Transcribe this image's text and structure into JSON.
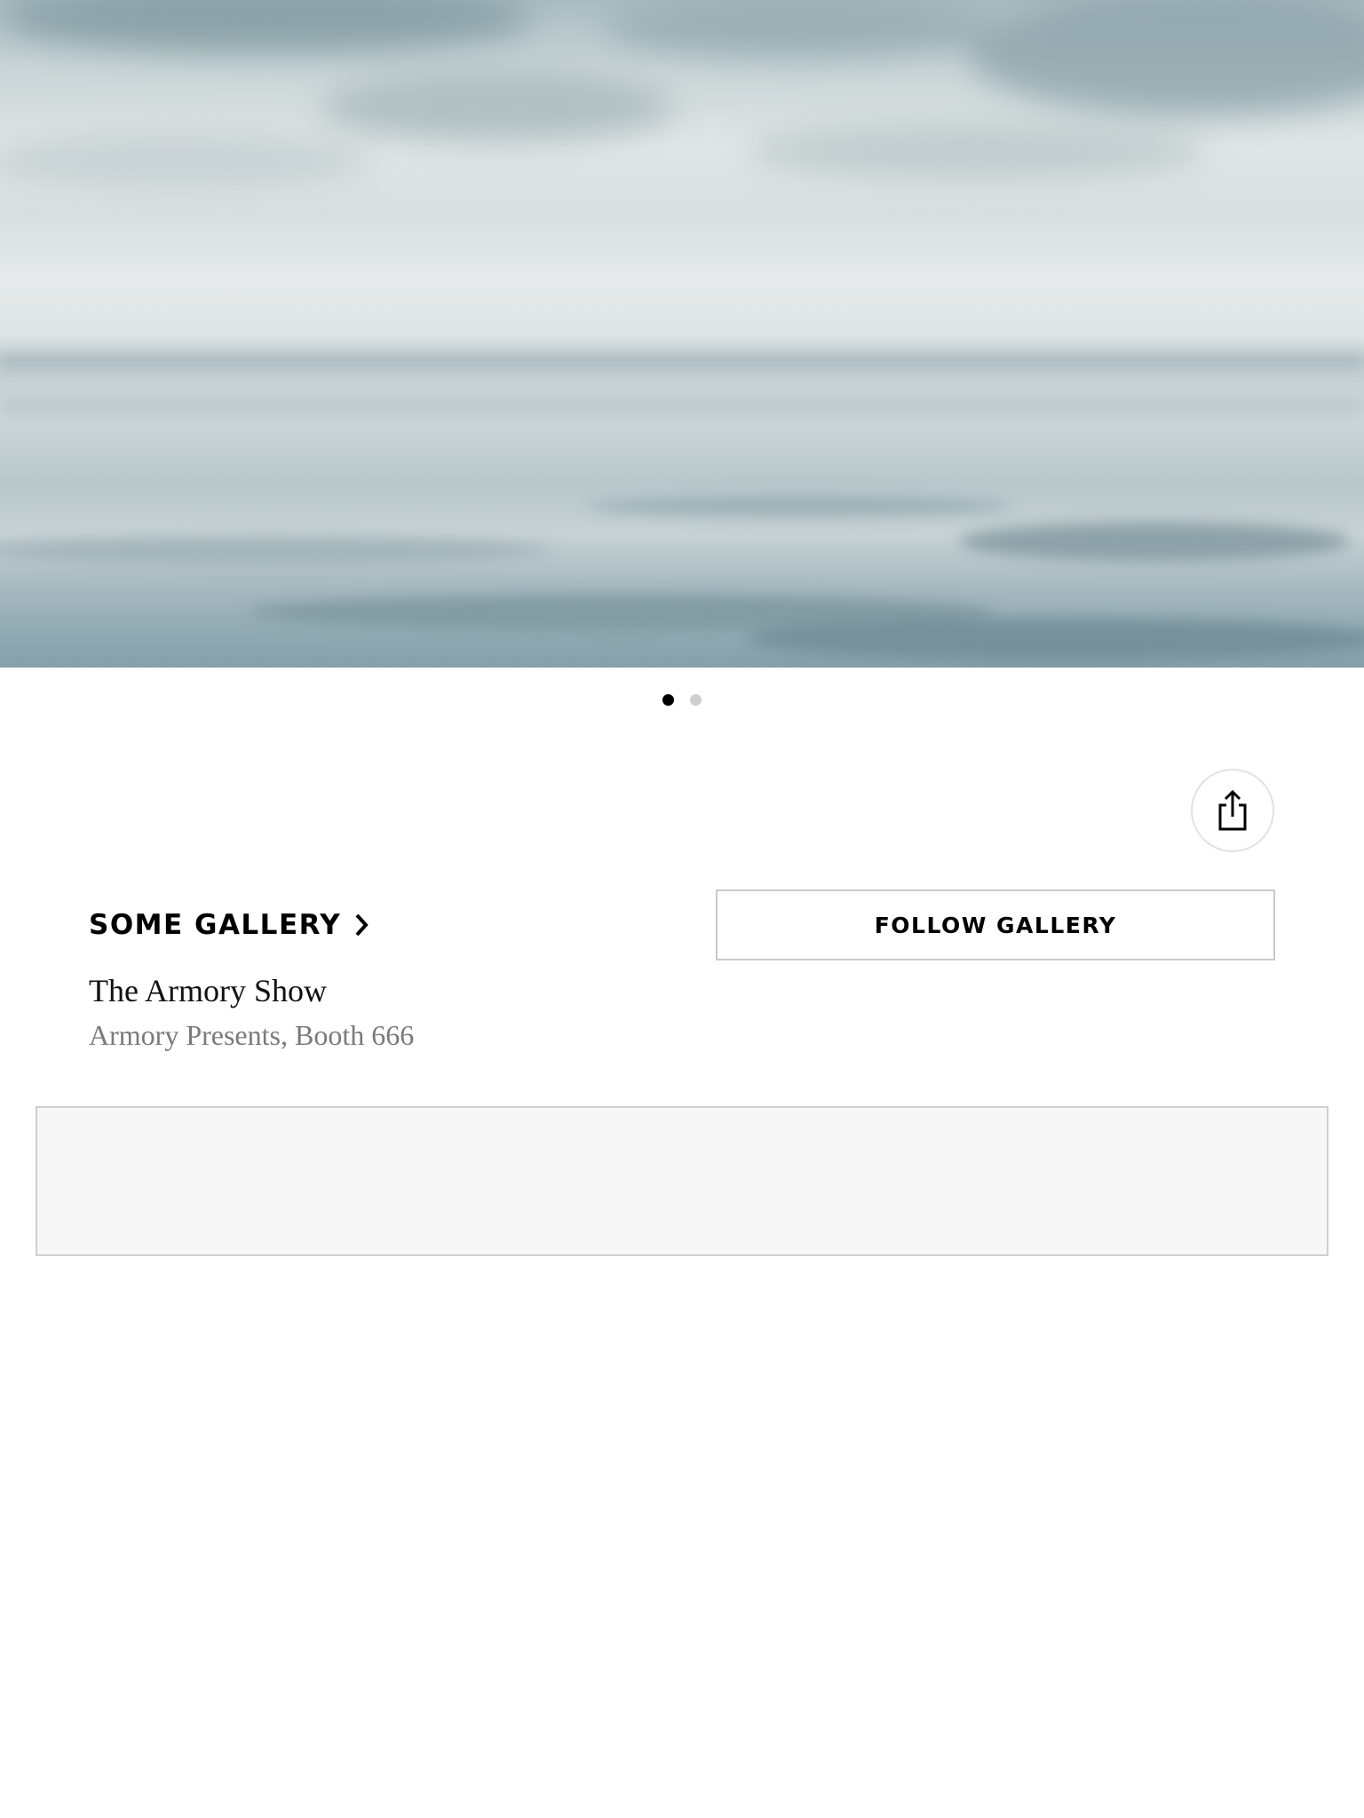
{
  "artwork": {
    "image_icon": "artwork-image",
    "pager": {
      "count": 2,
      "active_index": 0
    }
  },
  "actions": {
    "share_icon": "share-icon"
  },
  "gallery": {
    "name": "SOME GALLERY",
    "chevron_icon": "chevron-right-icon",
    "follow_label": "FOLLOW GALLERY"
  },
  "fair": {
    "name": "The Armory Show",
    "location": "Armory Presents, Booth 666"
  },
  "colors": {
    "text": "#000000",
    "secondary_text": "#7a7a7a",
    "border": "#c9c9c9",
    "panel_bg": "#f7f7f7"
  }
}
